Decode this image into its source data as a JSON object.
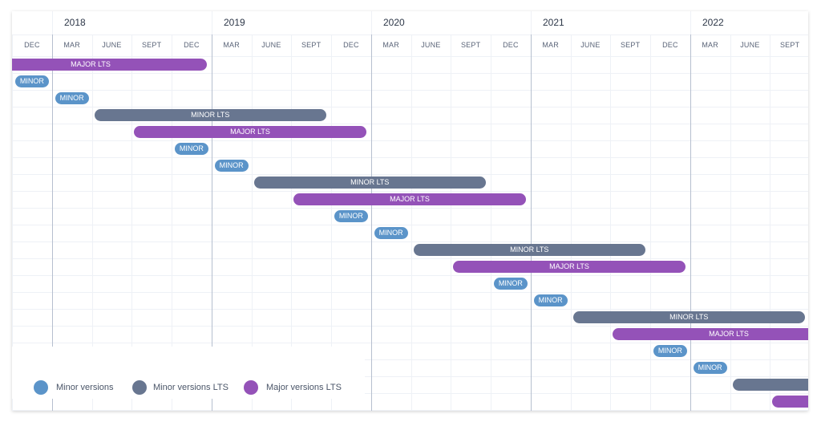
{
  "chart_data": {
    "type": "timeline",
    "title": "",
    "years": [
      "2018",
      "2019",
      "2020",
      "2021",
      "2022"
    ],
    "month_ticks": [
      "DEC",
      "MAR",
      "JUNE",
      "SEPT",
      "DEC",
      "MAR",
      "JUNE",
      "SEPT",
      "DEC",
      "MAR",
      "JUNE",
      "SEPT",
      "DEC",
      "MAR",
      "JUNE",
      "SEPT",
      "DEC",
      "MAR",
      "JUNE",
      "SEPT"
    ],
    "x_range": [
      "2017-12",
      "2022-09"
    ],
    "grid": true,
    "legend_placement": "bottom-left",
    "colors": {
      "minor": "#5b94c9",
      "minor_lts": "#687690",
      "major_lts": "#9452b8"
    },
    "legend": [
      {
        "type": "minor",
        "label": "Minor versions"
      },
      {
        "type": "minor_lts",
        "label": "Minor versions LTS"
      },
      {
        "type": "major_lts",
        "label": "Major versions LTS"
      }
    ],
    "bars": [
      {
        "type": "major_lts",
        "label": "MAJOR LTS",
        "start": "2017-09",
        "end": "2018-12"
      },
      {
        "type": "minor",
        "label": "MINOR",
        "start": "2017-12",
        "end": "2017-12"
      },
      {
        "type": "minor",
        "label": "MINOR",
        "start": "2018-03",
        "end": "2018-03"
      },
      {
        "type": "minor_lts",
        "label": "MINOR LTS",
        "start": "2018-06",
        "end": "2019-09"
      },
      {
        "type": "major_lts",
        "label": "MAJOR LTS",
        "start": "2018-09",
        "end": "2019-12"
      },
      {
        "type": "minor",
        "label": "MINOR",
        "start": "2018-12",
        "end": "2018-12"
      },
      {
        "type": "minor",
        "label": "MINOR",
        "start": "2019-03",
        "end": "2019-03"
      },
      {
        "type": "minor_lts",
        "label": "MINOR LTS",
        "start": "2019-06",
        "end": "2020-09"
      },
      {
        "type": "major_lts",
        "label": "MAJOR LTS",
        "start": "2019-09",
        "end": "2020-12"
      },
      {
        "type": "minor",
        "label": "MINOR",
        "start": "2019-12",
        "end": "2019-12"
      },
      {
        "type": "minor",
        "label": "MINOR",
        "start": "2020-03",
        "end": "2020-03"
      },
      {
        "type": "minor_lts",
        "label": "MINOR LTS",
        "start": "2020-06",
        "end": "2021-09"
      },
      {
        "type": "major_lts",
        "label": "MAJOR LTS",
        "start": "2020-09",
        "end": "2021-12"
      },
      {
        "type": "minor",
        "label": "MINOR",
        "start": "2020-12",
        "end": "2020-12"
      },
      {
        "type": "minor",
        "label": "MINOR",
        "start": "2021-03",
        "end": "2021-03"
      },
      {
        "type": "minor_lts",
        "label": "MINOR LTS",
        "start": "2021-06",
        "end": "2022-09"
      },
      {
        "type": "major_lts",
        "label": "MAJOR LTS",
        "start": "2021-09",
        "end": "2022-12"
      },
      {
        "type": "minor",
        "label": "MINOR",
        "start": "2021-12",
        "end": "2021-12"
      },
      {
        "type": "minor",
        "label": "MINOR",
        "start": "2022-03",
        "end": "2022-03"
      },
      {
        "type": "minor_lts",
        "label": "",
        "start": "2022-06",
        "end": "2023-09"
      },
      {
        "type": "major_lts",
        "label": "",
        "start": "2022-09",
        "end": "2023-12"
      }
    ]
  }
}
